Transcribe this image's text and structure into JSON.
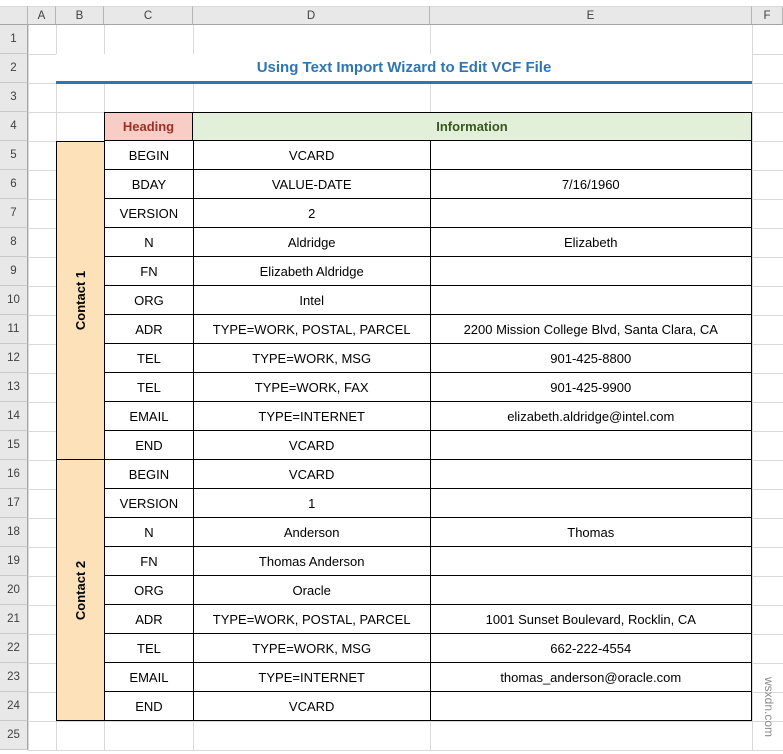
{
  "watermark": "wsxdn.com",
  "sheet": {
    "column_headers": [
      "A",
      "B",
      "C",
      "D",
      "E",
      "F"
    ],
    "row_count": 25
  },
  "title": {
    "text": "Using Text Import Wizard to Edit VCF File"
  },
  "table": {
    "header": {
      "heading": "Heading",
      "information": "Information"
    },
    "sections": [
      {
        "label": "Contact 1",
        "rows": [
          {
            "heading": "BEGIN",
            "info1": "VCARD",
            "info2": ""
          },
          {
            "heading": "BDAY",
            "info1": "VALUE-DATE",
            "info2": "7/16/1960"
          },
          {
            "heading": "VERSION",
            "info1": "2",
            "info2": ""
          },
          {
            "heading": "N",
            "info1": "Aldridge",
            "info2": "Elizabeth"
          },
          {
            "heading": "FN",
            "info1": "Elizabeth Aldridge",
            "info2": ""
          },
          {
            "heading": "ORG",
            "info1": "Intel",
            "info2": ""
          },
          {
            "heading": "ADR",
            "info1": "TYPE=WORK, POSTAL, PARCEL",
            "info2": "2200 Mission College Blvd, Santa Clara, CA"
          },
          {
            "heading": "TEL",
            "info1": "TYPE=WORK, MSG",
            "info2": "901-425-8800"
          },
          {
            "heading": "TEL",
            "info1": "TYPE=WORK, FAX",
            "info2": "901-425-9900"
          },
          {
            "heading": "EMAIL",
            "info1": "TYPE=INTERNET",
            "info2": "elizabeth.aldridge@intel.com"
          },
          {
            "heading": "END",
            "info1": "VCARD",
            "info2": ""
          }
        ]
      },
      {
        "label": "Contact 2",
        "rows": [
          {
            "heading": "BEGIN",
            "info1": "VCARD",
            "info2": ""
          },
          {
            "heading": "VERSION",
            "info1": "1",
            "info2": ""
          },
          {
            "heading": "N",
            "info1": "Anderson",
            "info2": "Thomas"
          },
          {
            "heading": "FN",
            "info1": "Thomas Anderson",
            "info2": ""
          },
          {
            "heading": "ORG",
            "info1": "Oracle",
            "info2": ""
          },
          {
            "heading": "ADR",
            "info1": "TYPE=WORK, POSTAL, PARCEL",
            "info2": "1001 Sunset Boulevard, Rocklin, CA"
          },
          {
            "heading": "TEL",
            "info1": "TYPE=WORK, MSG",
            "info2": "662-222-4554"
          },
          {
            "heading": "EMAIL",
            "info1": "TYPE=INTERNET",
            "info2": "thomas_anderson@oracle.com"
          },
          {
            "heading": "END",
            "info1": "VCARD",
            "info2": ""
          }
        ]
      }
    ]
  },
  "colors": {
    "title_blue": "#2E75B6",
    "heading_fill": "#F8CDC5",
    "heading_text": "#9C3025",
    "info_fill": "#E2EFD9",
    "info_text": "#385723",
    "contact_fill": "#FDE2B9"
  }
}
